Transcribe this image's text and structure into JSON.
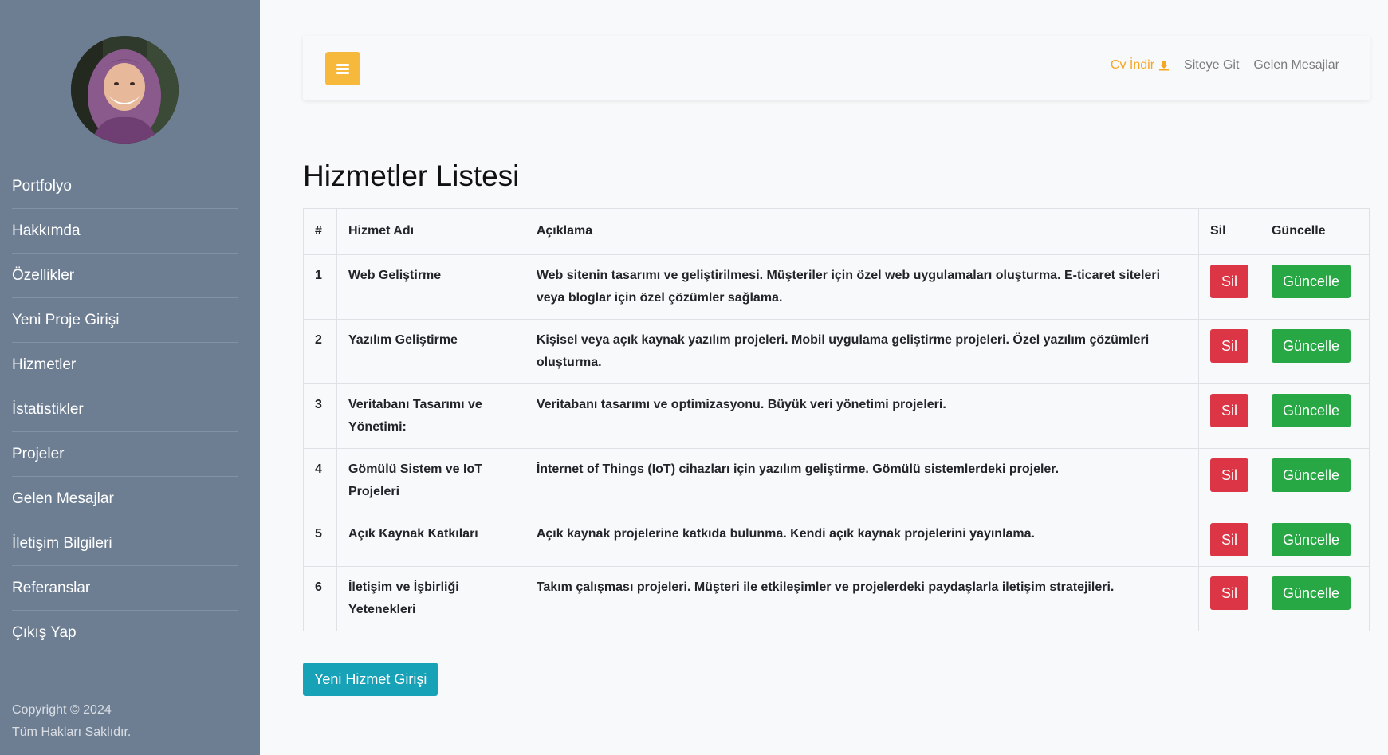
{
  "sidebar": {
    "nav": [
      "Portfolyo",
      "Hakkımda",
      "Özellikler",
      "Yeni Proje Girişi",
      "Hizmetler",
      "İstatistikler",
      "Projeler",
      "Gelen Mesajlar",
      "İletişim Bilgileri",
      "Referanslar",
      "Çıkış Yap"
    ],
    "copyright": "Copyright © 2024",
    "rights": "Tüm Hakları Saklıdır."
  },
  "topbar": {
    "cv_download": "Cv İndir",
    "go_site": "Siteye Git",
    "messages": "Gelen Mesajlar",
    "accent_color": "#f6a623",
    "toggle_color": "#f6b93b"
  },
  "page": {
    "title": "Hizmetler Listesi",
    "new_button": "Yeni Hizmet Girişi"
  },
  "table": {
    "headers": [
      "#",
      "Hizmet Adı",
      "Açıklama",
      "Sil",
      "Güncelle"
    ],
    "delete_label": "Sil",
    "update_label": "Güncelle",
    "rows": [
      {
        "id": "1",
        "name": "Web Geliştirme",
        "desc": "Web sitenin tasarımı ve geliştirilmesi. Müşteriler için özel web uygulamaları oluşturma. E-ticaret siteleri veya bloglar için özel çözümler sağlama."
      },
      {
        "id": "2",
        "name": "Yazılım Geliştirme",
        "desc": "Kişisel veya açık kaynak yazılım projeleri. Mobil uygulama geliştirme projeleri. Özel yazılım çözümleri oluşturma."
      },
      {
        "id": "3",
        "name": "Veritabanı Tasarımı ve Yönetimi:",
        "desc": "Veritabanı tasarımı ve optimizasyonu. Büyük veri yönetimi projeleri."
      },
      {
        "id": "4",
        "name": "Gömülü Sistem ve IoT Projeleri",
        "desc": "İnternet of Things (IoT) cihazları için yazılım geliştirme. Gömülü sistemlerdeki projeler."
      },
      {
        "id": "5",
        "name": "Açık Kaynak Katkıları",
        "desc": "Açık kaynak projelerine katkıda bulunma. Kendi açık kaynak projelerini yayınlama."
      },
      {
        "id": "6",
        "name": "İletişim ve İşbirliği Yetenekleri",
        "desc": "Takım çalışması projeleri. Müşteri ile etkileşimler ve projelerdeki paydaşlarla iletişim stratejileri."
      }
    ]
  },
  "colors": {
    "sidebar_bg": "#6d7e93",
    "danger": "#dc3545",
    "success": "#28a745",
    "info": "#17a2b8"
  }
}
